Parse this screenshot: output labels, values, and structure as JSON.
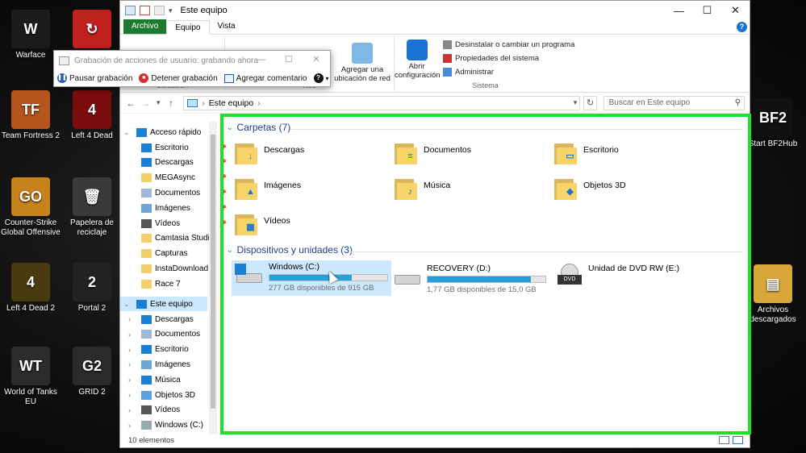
{
  "desktop": {
    "left_icons": [
      {
        "label": "Warface",
        "color": "#1c1c1c",
        "glyph": "W"
      },
      {
        "label": "Team Fortress 2",
        "color": "#b5541c",
        "glyph": "TF"
      },
      {
        "label": "Counter-Strike Global Offensive",
        "color": "#c7821b",
        "glyph": "GO"
      },
      {
        "label": "Left 4 Dead 2",
        "color": "#4a3a12",
        "glyph": "4"
      },
      {
        "label": "World of Tanks EU",
        "color": "#2c2c2c",
        "glyph": "WT"
      }
    ],
    "col2_icons": [
      {
        "label": "",
        "color": "#c0211f",
        "glyph": "↻"
      },
      {
        "label": "Left 4 Dead",
        "color": "#7a0e0e",
        "glyph": "4"
      },
      {
        "label": "Papelera de reciclaje",
        "color": "#3a3a3a",
        "glyph": "🗑"
      },
      {
        "label": "Portal 2",
        "color": "#222",
        "glyph": "2"
      },
      {
        "label": "GRID 2",
        "color": "#2a2a2a",
        "glyph": "G2"
      }
    ],
    "right_icons": [
      {
        "label": "Start BF2Hub",
        "color": "#111",
        "glyph": "BF2"
      },
      {
        "label": "Archivos descargados",
        "color": "#d9a63a",
        "glyph": "▤"
      }
    ]
  },
  "window": {
    "title": "Este equipo",
    "controls": {
      "minimize": "—",
      "maximize": "☐",
      "close": "✕"
    }
  },
  "ribbon": {
    "tabs": {
      "file": "Archivo",
      "computer": "Equipo",
      "view": "Vista"
    },
    "help": "?",
    "groups": {
      "location": "Ubicación",
      "network": "Red",
      "system": "Sistema"
    },
    "add_network_location": "Agregar una ubicación de red",
    "open_settings": "Abrir configuración",
    "uninstall": "Desinstalar o cambiar un programa",
    "system_properties": "Propiedades del sistema",
    "manage": "Administrar"
  },
  "steps_recorder": {
    "title": "Grabación de acciones de usuario: grabando ahora",
    "pause": "Pausar grabación",
    "stop": "Detener grabación",
    "add_comment": "Agregar comentario",
    "help": "?",
    "minimize": "—",
    "maximize": "☐",
    "close": "✕"
  },
  "address": {
    "back": "←",
    "forward": "→",
    "recent": "▾",
    "up": "↑",
    "path": "Este equipo",
    "sep": "›",
    "dropdown": "▾",
    "refresh": "↻",
    "search_placeholder": "Buscar en Este equipo",
    "search_icon": "⚲"
  },
  "nav": {
    "quick_access": "Acceso rápido",
    "quick_items": [
      {
        "label": "Escritorio",
        "pinned": true,
        "icon": "desktop-icon"
      },
      {
        "label": "Descargas",
        "pinned": true,
        "icon": "download-icon"
      },
      {
        "label": "MEGAsync",
        "pinned": true,
        "icon": "folder-icon"
      },
      {
        "label": "Documentos",
        "pinned": true,
        "icon": "documents-icon"
      },
      {
        "label": "Imágenes",
        "pinned": true,
        "icon": "pictures-icon"
      },
      {
        "label": "Vídeos",
        "pinned": true,
        "icon": "videos-icon"
      },
      {
        "label": "Camtasia Studio",
        "pinned": false,
        "icon": "folder-icon"
      },
      {
        "label": "Capturas",
        "pinned": false,
        "icon": "folder-icon"
      },
      {
        "label": "InstaDownload",
        "pinned": false,
        "icon": "folder-icon"
      },
      {
        "label": "Race 7",
        "pinned": false,
        "icon": "folder-icon"
      }
    ],
    "this_pc": "Este equipo",
    "pc_items": [
      {
        "label": "Descargas",
        "icon": "download-icon"
      },
      {
        "label": "Documentos",
        "icon": "documents-icon"
      },
      {
        "label": "Escritorio",
        "icon": "desktop-icon"
      },
      {
        "label": "Imágenes",
        "icon": "pictures-icon"
      },
      {
        "label": "Música",
        "icon": "music-icon"
      },
      {
        "label": "Objetos 3D",
        "icon": "objects-3d-icon"
      },
      {
        "label": "Vídeos",
        "icon": "videos-icon"
      },
      {
        "label": "Windows (C:)",
        "icon": "drive-icon"
      }
    ],
    "pin_glyph": "📌",
    "chev_open": "⌄",
    "chev_closed": "›"
  },
  "content": {
    "folders_header": "Carpetas (7)",
    "folders": [
      {
        "label": "Descargas",
        "emblem": "↓"
      },
      {
        "label": "Documentos",
        "emblem": "≡"
      },
      {
        "label": "Escritorio",
        "emblem": "▭"
      },
      {
        "label": "Imágenes",
        "emblem": "▲"
      },
      {
        "label": "Música",
        "emblem": "♪"
      },
      {
        "label": "Objetos 3D",
        "emblem": "◆"
      },
      {
        "label": "Vídeos",
        "emblem": "▦"
      }
    ],
    "devices_header": "Dispositivos y unidades (3)",
    "drives": [
      {
        "label": "Windows (C:)",
        "free": "277 GB disponibles de 915 GB",
        "used_fraction": 0.7,
        "system": true
      },
      {
        "label": "RECOVERY (D:)",
        "free": "1,77 GB disponibles de 15,0 GB",
        "used_fraction": 0.88,
        "system": false
      },
      {
        "label": "Unidad de DVD RW (E:)",
        "free": "",
        "used_fraction": null,
        "dvd": true
      }
    ]
  },
  "status": {
    "items": "10 elementos"
  },
  "colors": {
    "accent": "#22e02a",
    "file_tab": "#1e7a2f",
    "bar": "#26a0da",
    "selection": "#cce8ff"
  }
}
